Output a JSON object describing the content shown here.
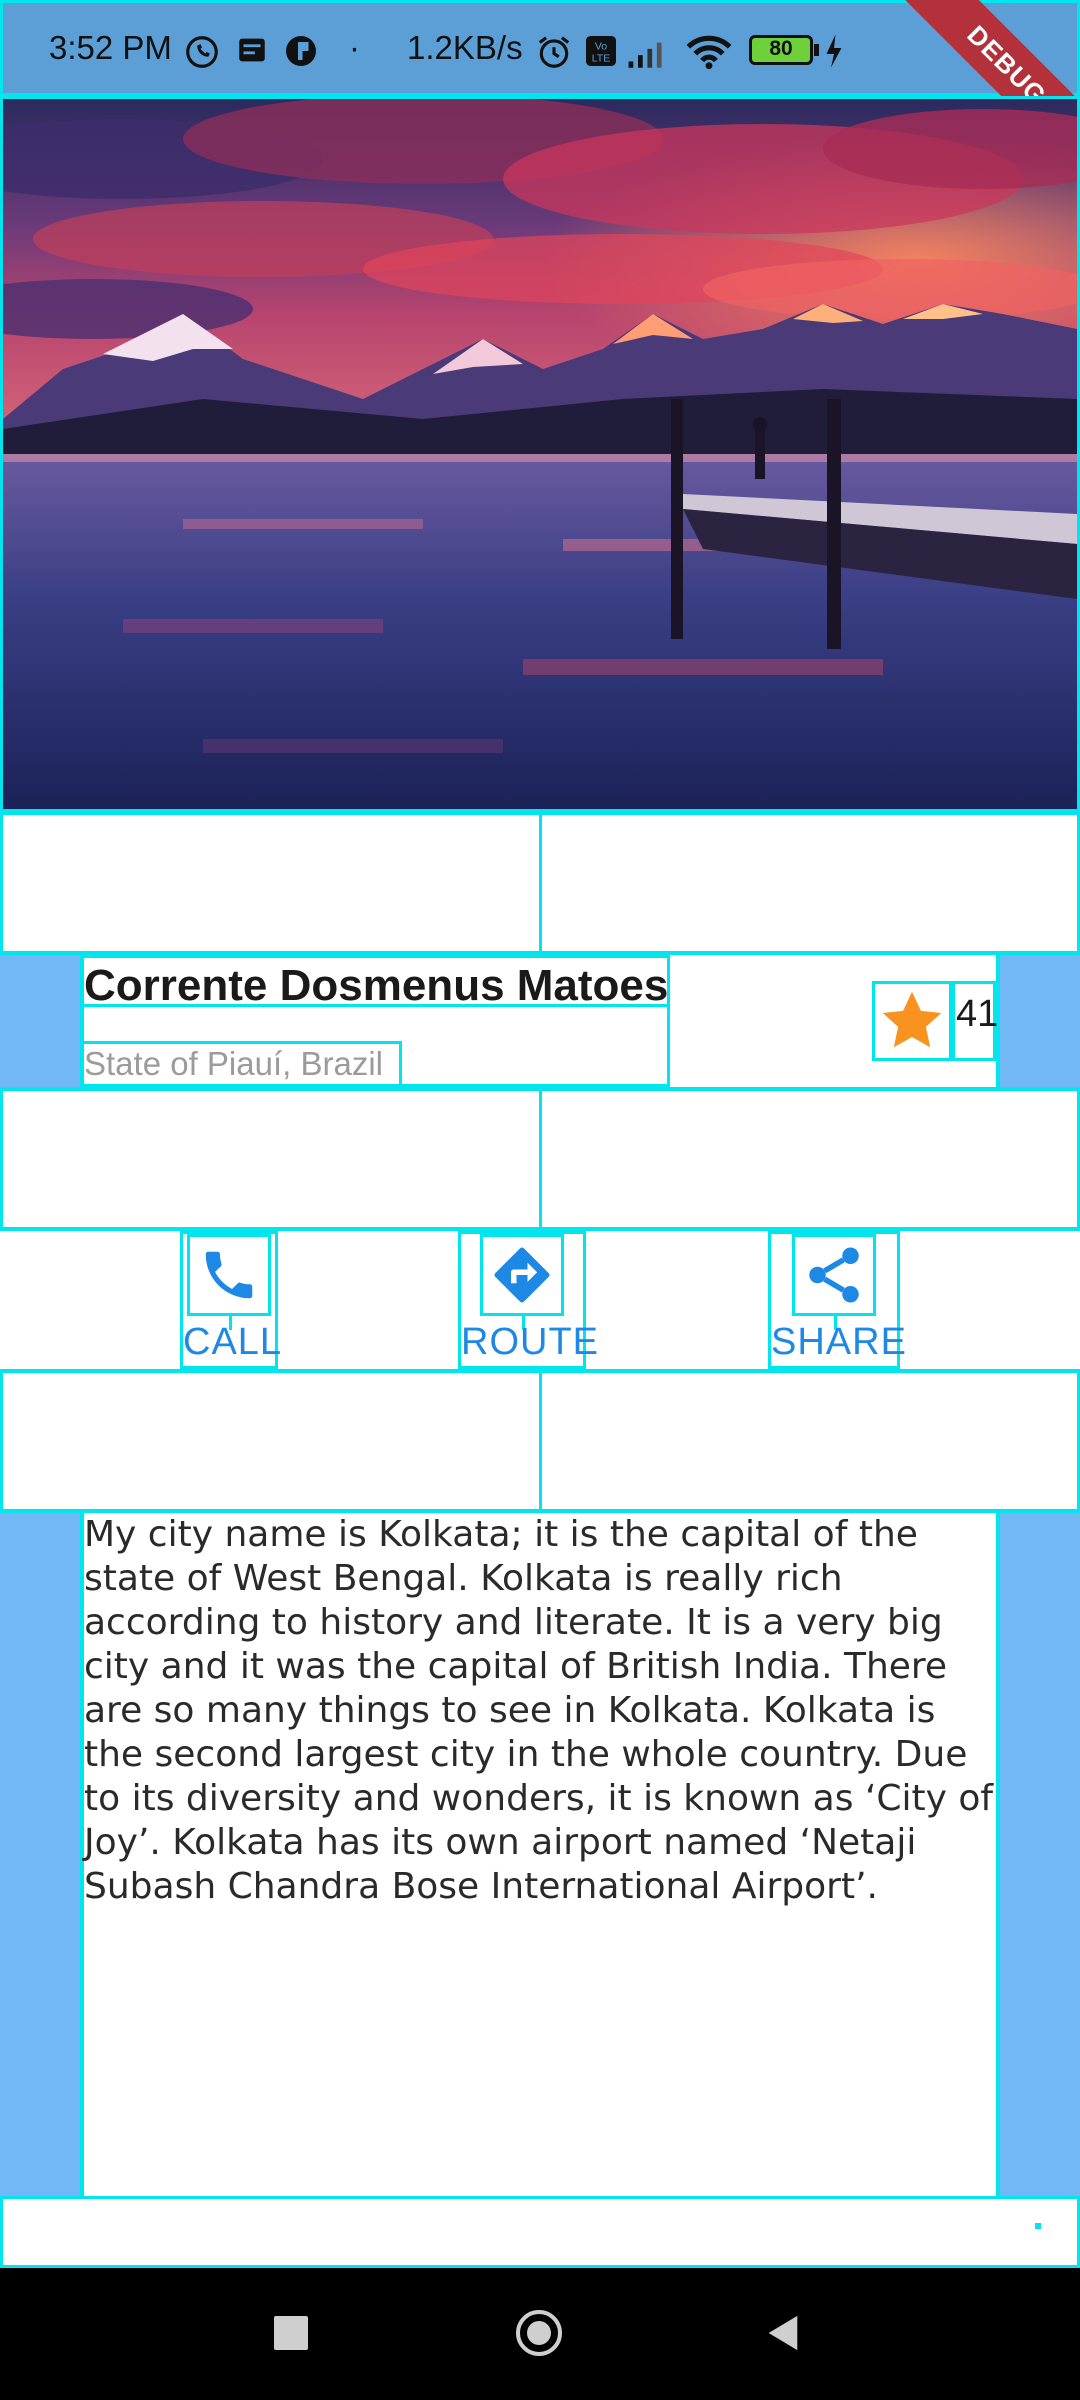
{
  "status_bar": {
    "time": "3:52 PM",
    "dot": "·",
    "network_speed": "1.2KB/s",
    "battery": "80",
    "icons": [
      "whatsapp-icon",
      "sim-icon",
      "app-icon",
      "alarm-icon",
      "volte-icon",
      "signal-icon",
      "wifi-icon",
      "battery-icon",
      "charging-icon"
    ],
    "debug_label": "DEBUG"
  },
  "hero": {
    "description": ""
  },
  "place": {
    "title": "Corrente Dosmenus Matoes",
    "subtitle": "State of Piauí, Brazil",
    "rating": "41"
  },
  "actions": [
    {
      "label": "CALL",
      "icon": "phone-icon"
    },
    {
      "label": "ROUTE",
      "icon": "directions-icon"
    },
    {
      "label": "SHARE",
      "icon": "share-icon"
    }
  ],
  "description": "My city name is Kolkata; it is the capital of the state of West Bengal. Kolkata is really rich according to history and literate. It is a very big city and it was the capital of British India. There are so many things to see in Kolkata. Kolkata is the second largest city in the whole country. Due to its diversity and wonders, it is known as ‘City of Joy’. Kolkata has its own airport named ‘Netaji Subash Chandra Bose International Airport’.",
  "colors": {
    "accent": "#1e88e5",
    "star": "#f7931e",
    "side_pad": "#71b8f5",
    "debug_outline": "#00e5ee"
  }
}
